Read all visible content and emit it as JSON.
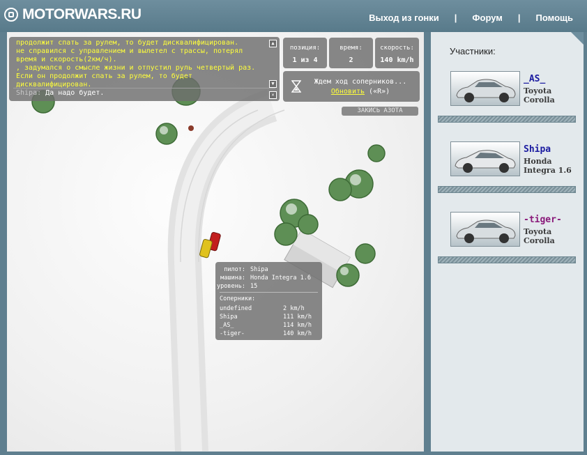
{
  "header": {
    "logo_text": "MOTORWARS.RU",
    "nav": [
      {
        "label": "Выход из гонки"
      },
      {
        "label": "Форум"
      },
      {
        "label": "Помощь"
      }
    ]
  },
  "chat": {
    "lines": [
      {
        "text": "продолжит спать за рулем, то будет дисквалифицирован.",
        "color": "yellow"
      },
      {
        "text": " не справился с управлением и вылетел с трассы, потерял время и скорость(2км/ч).",
        "color": "yellow"
      },
      {
        "text": ", задумался о смысле жизни и отпустил руль четвертый раз. Если он продолжит спать за рулем, то будет дисквалифицирован.",
        "color": "yellow"
      }
    ],
    "last_message": {
      "author": "Shipa:",
      "text": "Да надо будет."
    }
  },
  "stats": {
    "position": {
      "label": "позиция:",
      "value": "1 из 4"
    },
    "time": {
      "label": "время:",
      "value": "2"
    },
    "speed": {
      "label": "скорость:",
      "value": "140 km/h"
    }
  },
  "waiting": {
    "message": "Ждем ход соперников...",
    "refresh_link": "Обновить",
    "shortcut": "(«R»)"
  },
  "nitro_button": "ЗАКИСЬ АЗОТА",
  "info_panel": {
    "pilot_label": "пилот:",
    "pilot": "Shipa",
    "car_label": "машина:",
    "car": "Honda Integra 1.6",
    "level_label": "уровень:",
    "level": "15",
    "rivals_label": "Соперники:",
    "rivals": [
      {
        "name": "undefined",
        "speed": "2 km/h"
      },
      {
        "name": "Shipa",
        "speed": "111 km/h"
      },
      {
        "name": "_AS_",
        "speed": "114 km/h"
      },
      {
        "name": "-tiger-",
        "speed": "140 km/h"
      }
    ]
  },
  "sidebar": {
    "title": "Участники:",
    "players": [
      {
        "name": "_AS_",
        "car": "Toyota Corolla",
        "color": "#1a1aa0"
      },
      {
        "name": "Shipa",
        "car": "Honda Integra 1.6",
        "color": "#1a1aa0"
      },
      {
        "name": "-tiger-",
        "car": "Toyota Corolla",
        "color": "#8a1a7a"
      }
    ]
  }
}
